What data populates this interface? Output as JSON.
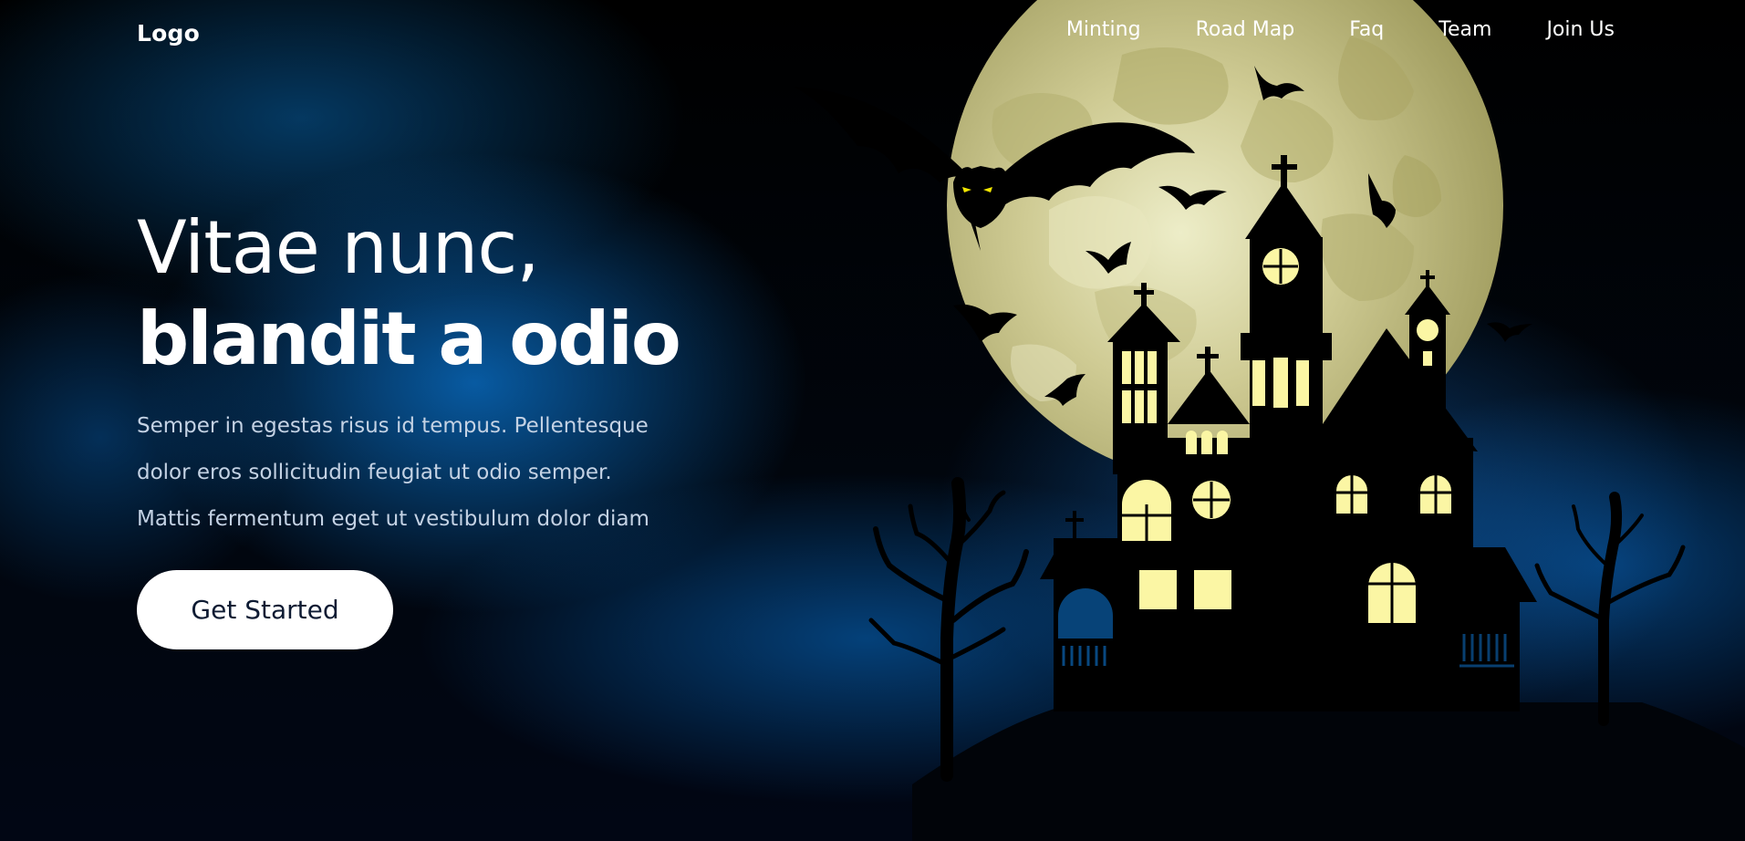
{
  "header": {
    "logo": "Logo",
    "nav": [
      {
        "label": "Minting"
      },
      {
        "label": "Road Map"
      },
      {
        "label": "Faq"
      },
      {
        "label": "Team"
      },
      {
        "label": "Join Us"
      }
    ]
  },
  "hero": {
    "title_light": "Vitae nunc,",
    "title_bold": "blandit a odio",
    "description_lines": [
      "Semper in egestas risus id tempus. Pellentesque",
      "dolor eros sollicitudin feugiat ut odio semper.",
      "Mattis fermentum eget ut vestibulum dolor diam"
    ],
    "cta_label": "Get Started"
  },
  "illustration": {
    "subject": "haunted-house-illustration",
    "colors": {
      "moon": "#c9c58d",
      "window_glow": "#fbf6a4",
      "silhouette": "#000000",
      "bat_eyes": "#f2e600"
    }
  }
}
